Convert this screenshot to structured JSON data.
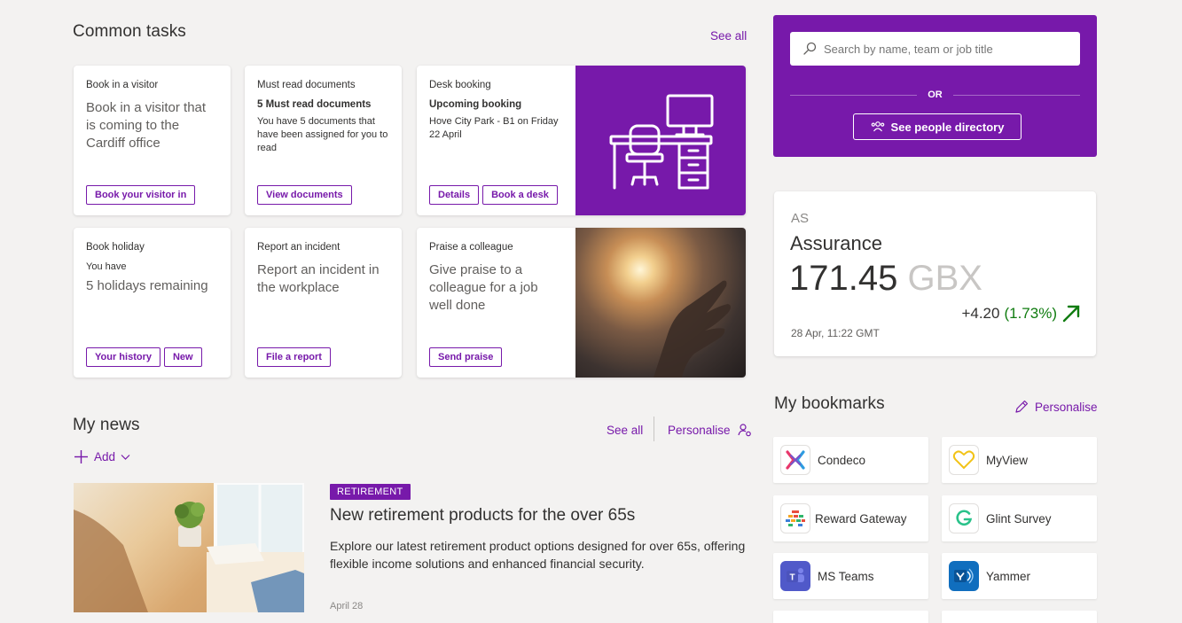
{
  "common_tasks": {
    "title": "Common tasks",
    "see_all": "See all",
    "cards": [
      {
        "eyebrow": "Book in a visitor",
        "text": "Book in a visitor that is coming to the Cardiff office",
        "buttons": [
          "Book your visitor in"
        ]
      },
      {
        "eyebrow": "Must read documents",
        "heading": "5 Must read documents",
        "text": "You have 5 documents that have been assigned for you to read",
        "buttons": [
          "View documents"
        ]
      },
      {
        "eyebrow": "Desk booking",
        "heading": "Upcoming booking",
        "text": "Hove City Park - B1 on Friday 22 April",
        "buttons": [
          "Details",
          "Book a desk"
        ]
      },
      {
        "eyebrow": "Book holiday",
        "sub": "You have",
        "text": "5 holidays remaining",
        "buttons": [
          "Your history",
          "New"
        ]
      },
      {
        "eyebrow": "Report an incident",
        "text": "Report an incident in the workplace",
        "buttons": [
          "File a report"
        ]
      },
      {
        "eyebrow": "Praise a colleague",
        "text": "Give praise to a colleague for a job well done",
        "buttons": [
          "Send praise"
        ]
      }
    ]
  },
  "people_search": {
    "placeholder": "Search by name, team or job title",
    "or_label": "OR",
    "directory_button": "See people directory",
    "accent": "#7719aa"
  },
  "stock": {
    "ticker": "AS",
    "name": "Assurance",
    "price": "171.45",
    "currency": "GBX",
    "change": "+4.20",
    "change_pct": "(1.73%)",
    "timestamp": "28 Apr, 11:22 GMT",
    "up_color": "#107c10"
  },
  "news": {
    "title": "My news",
    "see_all": "See all",
    "personalise": "Personalise",
    "add": "Add",
    "article": {
      "tag": "RETIREMENT",
      "headline": "New retirement products for the over 65s",
      "summary": "Explore our latest retirement product options designed for over 65s, offering flexible income solutions and enhanced financial security.",
      "date": "April 28"
    }
  },
  "bookmarks": {
    "title": "My bookmarks",
    "personalise": "Personalise",
    "items": [
      {
        "label": "Condeco",
        "icon": "condeco-icon"
      },
      {
        "label": "MyView",
        "icon": "heart-icon"
      },
      {
        "label": "Reward Gateway",
        "icon": "reward-gateway-icon"
      },
      {
        "label": "Glint Survey",
        "icon": "glint-icon"
      },
      {
        "label": "MS Teams",
        "icon": "teams-icon"
      },
      {
        "label": "Yammer",
        "icon": "yammer-icon"
      }
    ]
  }
}
